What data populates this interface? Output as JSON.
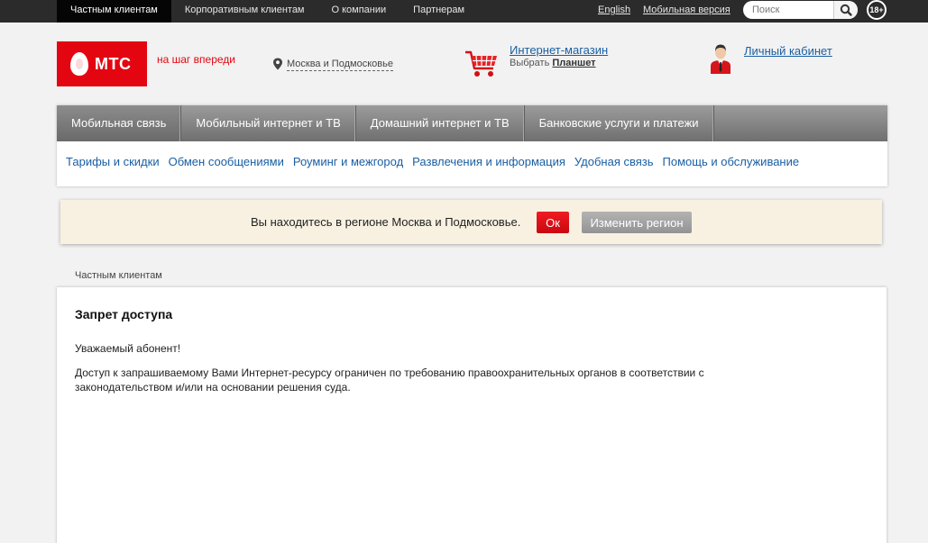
{
  "topbar": {
    "nav": [
      "Частным клиентам",
      "Корпоративным клиентам",
      "О компании",
      "Партнерам"
    ],
    "english": "English",
    "mobile_version": "Мобильная версия",
    "search_placeholder": "Поиск",
    "age_badge": "18+"
  },
  "header": {
    "logo_text": "МТС",
    "slogan": "на шаг впереди",
    "region": "Москва и Подмосковье",
    "shop_link": "Интернет-магазин",
    "shop_choose": "Выбрать",
    "shop_item": "Планшет",
    "cabinet_link": "Личный кабинет"
  },
  "main_nav": [
    "Мобильная связь",
    "Мобильный интернет и ТВ",
    "Домашний интернет и ТВ",
    "Банковские услуги и платежи"
  ],
  "sub_nav": [
    "Тарифы и скидки",
    "Обмен сообщениями",
    "Роуминг и межгород",
    "Развлечения и информация",
    "Удобная связь",
    "Помощь и обслуживание"
  ],
  "region_confirm": {
    "message": "Вы находитесь в регионе Москва и Подмосковье.",
    "ok_label": "Ок",
    "change_label": "Изменить регион"
  },
  "breadcrumb": "Частным клиентам",
  "content": {
    "title": "Запрет доступа",
    "greeting": "Уважаемый абонент!",
    "body": "Доступ к запрашиваемому Вами Интернет-ресурсу ограничен по требованию правоохранительных органов в соответствии с законодательством и/или на основании решения суда."
  },
  "colors": {
    "brand_red": "#e30611",
    "link_blue": "#1a5fa3",
    "topbar_bg": "#2b2b2b",
    "region_bar_bg": "#f8f1e2"
  }
}
